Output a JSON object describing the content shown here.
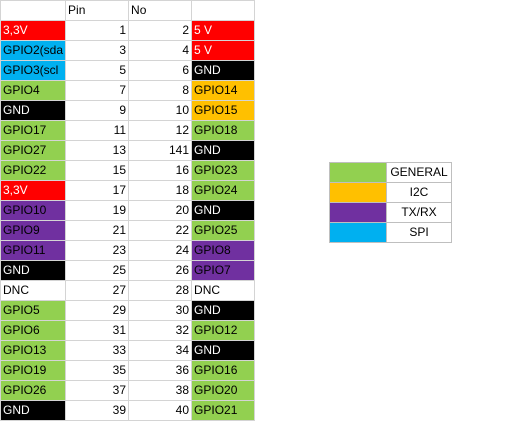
{
  "colors": {
    "red": "#ff0000",
    "green": "#92d050",
    "black": "#000000",
    "blue": "#00b0f0",
    "purple": "#7030a0",
    "orange": "#ffc000",
    "white": "#ffffff"
  },
  "table": {
    "headers": {
      "name_left": "",
      "pin": "Pin",
      "no": "No",
      "name_right": ""
    },
    "rows": [
      {
        "left": "3,3V",
        "left_color": "red",
        "pin_l": "1",
        "pin_r": "2",
        "right": "5 V",
        "right_color": "red"
      },
      {
        "left": "GPIO2(sda",
        "left_color": "blue",
        "pin_l": "3",
        "pin_r": "4",
        "right": "5 V",
        "right_color": "red"
      },
      {
        "left": "GPIO3(scl",
        "left_color": "blue",
        "pin_l": "5",
        "pin_r": "6",
        "right": "GND",
        "right_color": "black"
      },
      {
        "left": "GPIO4",
        "left_color": "green",
        "pin_l": "7",
        "pin_r": "8",
        "right": "GPIO14",
        "right_color": "orange"
      },
      {
        "left": "GND",
        "left_color": "black",
        "pin_l": "9",
        "pin_r": "10",
        "right": "GPIO15",
        "right_color": "orange"
      },
      {
        "left": "GPIO17",
        "left_color": "green",
        "pin_l": "11",
        "pin_r": "12",
        "right": "GPIO18",
        "right_color": "green"
      },
      {
        "left": "GPIO27",
        "left_color": "green",
        "pin_l": "13",
        "pin_r": "141",
        "right": "GND",
        "right_color": "black"
      },
      {
        "left": "GPIO22",
        "left_color": "green",
        "pin_l": "15",
        "pin_r": "16",
        "right": "GPIO23",
        "right_color": "green"
      },
      {
        "left": "3,3V",
        "left_color": "red",
        "pin_l": "17",
        "pin_r": "18",
        "right": "GPIO24",
        "right_color": "green"
      },
      {
        "left": "GPIO10",
        "left_color": "purple",
        "pin_l": "19",
        "pin_r": "20",
        "right": "GND",
        "right_color": "black"
      },
      {
        "left": "GPIO9",
        "left_color": "purple",
        "pin_l": "21",
        "pin_r": "22",
        "right": "GPIO25",
        "right_color": "green"
      },
      {
        "left": "GPIO11",
        "left_color": "purple",
        "pin_l": "23",
        "pin_r": "24",
        "right": "GPIO8",
        "right_color": "purple"
      },
      {
        "left": "GND",
        "left_color": "black",
        "pin_l": "25",
        "pin_r": "26",
        "right": "GPIO7",
        "right_color": "purple"
      },
      {
        "left": "DNC",
        "left_color": "white",
        "pin_l": "27",
        "pin_r": "28",
        "right": "DNC",
        "right_color": "white"
      },
      {
        "left": "GPIO5",
        "left_color": "green",
        "pin_l": "29",
        "pin_r": "30",
        "right": "GND",
        "right_color": "black"
      },
      {
        "left": "GPIO6",
        "left_color": "green",
        "pin_l": "31",
        "pin_r": "32",
        "right": "GPIO12",
        "right_color": "green"
      },
      {
        "left": "GPIO13",
        "left_color": "green",
        "pin_l": "33",
        "pin_r": "34",
        "right": "GND",
        "right_color": "black"
      },
      {
        "left": "GPIO19",
        "left_color": "green",
        "pin_l": "35",
        "pin_r": "36",
        "right": "GPIO16",
        "right_color": "green"
      },
      {
        "left": "GPIO26",
        "left_color": "green",
        "pin_l": "37",
        "pin_r": "38",
        "right": "GPIO20",
        "right_color": "green"
      },
      {
        "left": "GND",
        "left_color": "black",
        "pin_l": "39",
        "pin_r": "40",
        "right": "GPIO21",
        "right_color": "green"
      }
    ]
  },
  "legend": [
    {
      "label": "GENERAL",
      "color": "green"
    },
    {
      "label": "I2C",
      "color": "orange"
    },
    {
      "label": "TX/RX",
      "color": "purple"
    },
    {
      "label": "SPI",
      "color": "blue"
    }
  ]
}
